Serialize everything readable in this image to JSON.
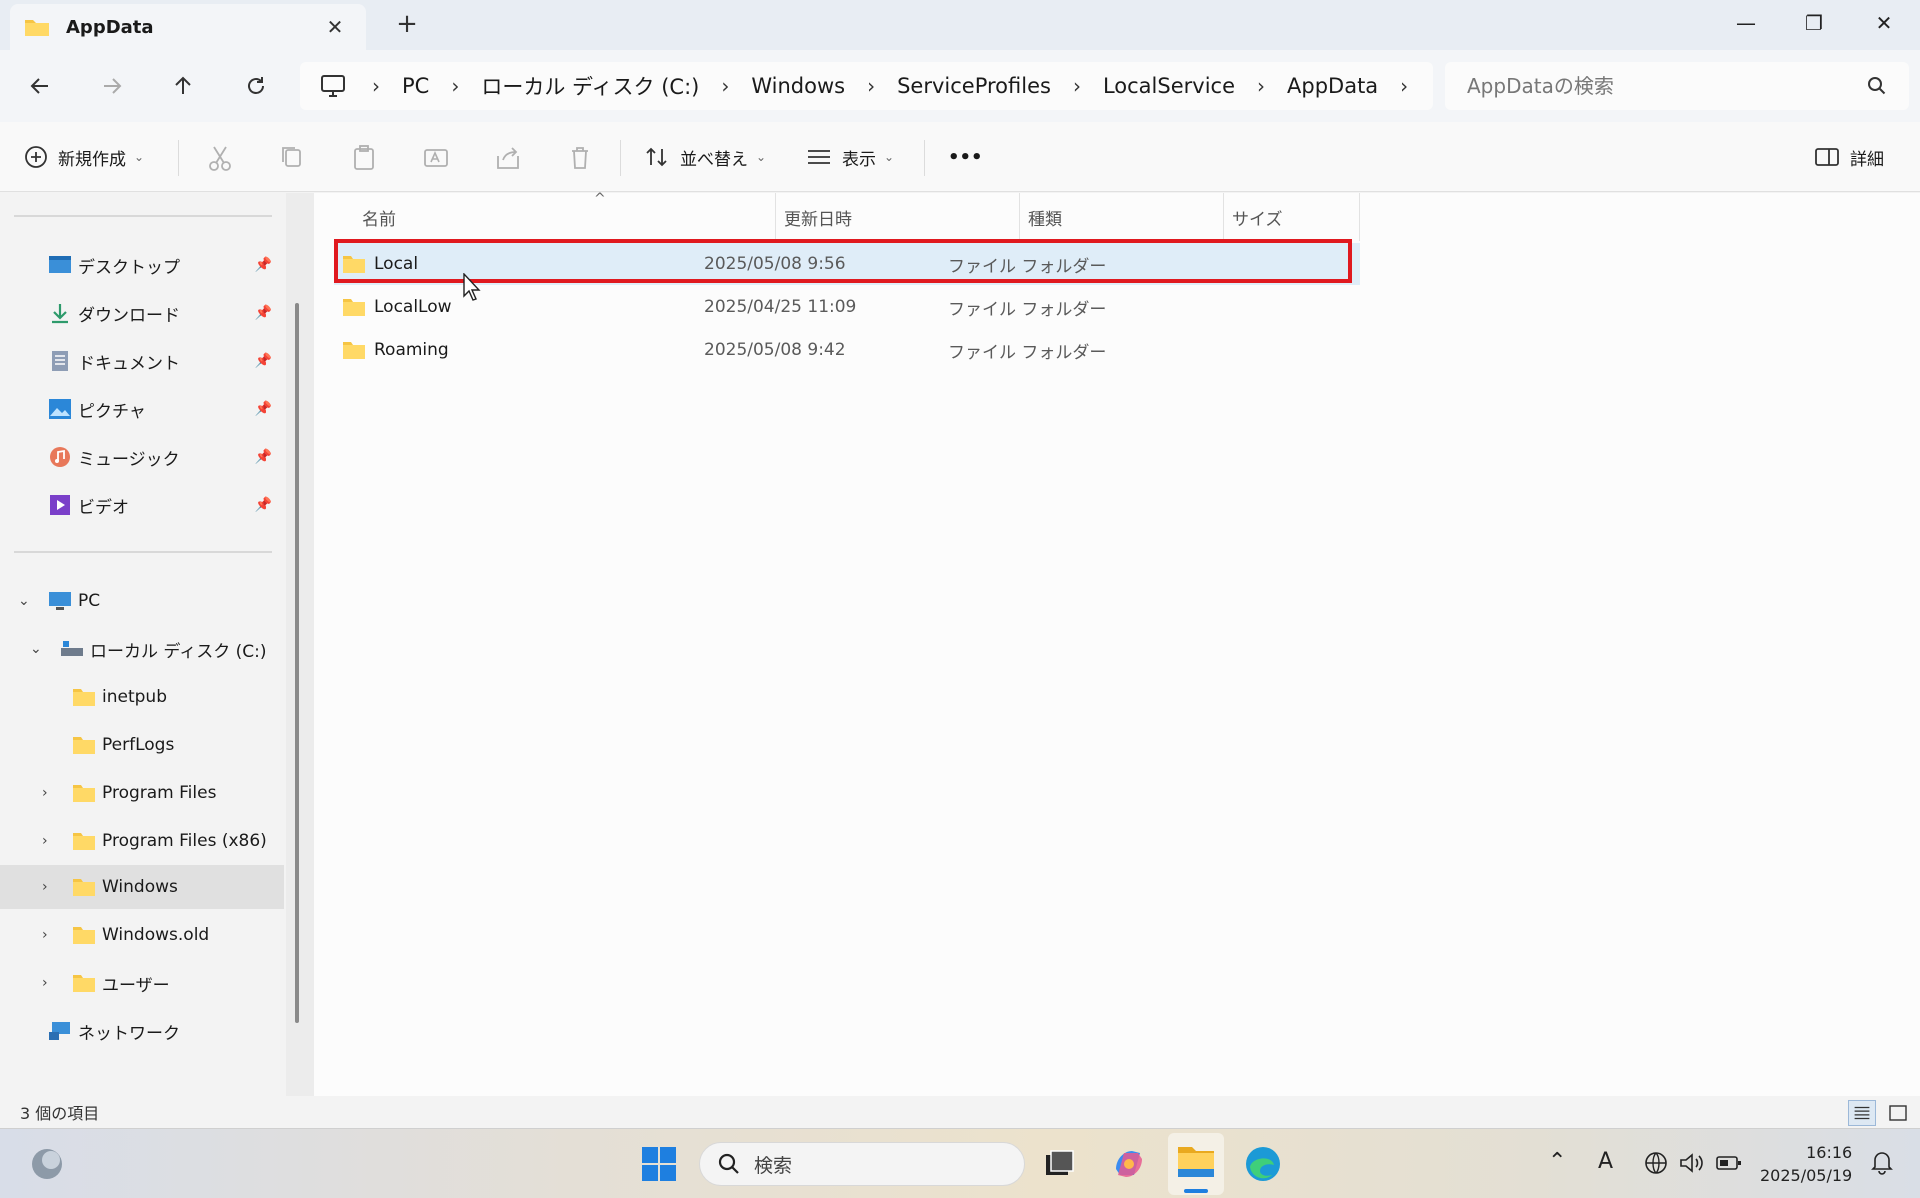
{
  "window": {
    "tab_title": "AppData",
    "tab_close": "✕",
    "new_tab": "+",
    "controls": {
      "minimize": "—",
      "maximize": "❐",
      "close": "✕"
    }
  },
  "address": {
    "crumbs": [
      "PC",
      "ローカル ディスク (C:)",
      "Windows",
      "ServiceProfiles",
      "LocalService",
      "AppData"
    ],
    "separator": "›",
    "search_placeholder": "AppDataの検索"
  },
  "commands": {
    "new": "新規作成",
    "sort": "並べ替え",
    "view": "表示",
    "more": "•••",
    "details": "詳細"
  },
  "sidebar": {
    "quick_access": [
      {
        "label": "デスクトップ",
        "icon": "desktop-icon"
      },
      {
        "label": "ダウンロード",
        "icon": "download-icon"
      },
      {
        "label": "ドキュメント",
        "icon": "documents-icon"
      },
      {
        "label": "ピクチャ",
        "icon": "pictures-icon"
      },
      {
        "label": "ミュージック",
        "icon": "music-icon"
      },
      {
        "label": "ビデオ",
        "icon": "videos-icon"
      }
    ],
    "tree": {
      "pc": "PC",
      "drive": "ローカル ディスク (C:)",
      "folders": [
        "inetpub",
        "PerfLogs",
        "Program Files",
        "Program Files (x86)",
        "Windows",
        "Windows.old",
        "ユーザー"
      ],
      "network": "ネットワーク"
    },
    "selected": "Windows"
  },
  "columns": {
    "name": "名前",
    "date": "更新日時",
    "type": "種類",
    "size": "サイズ"
  },
  "files": [
    {
      "name": "Local",
      "date": "2025/05/08 9:56",
      "type": "ファイル フォルダー",
      "size": ""
    },
    {
      "name": "LocalLow",
      "date": "2025/04/25 11:09",
      "type": "ファイル フォルダー",
      "size": ""
    },
    {
      "name": "Roaming",
      "date": "2025/05/08 9:42",
      "type": "ファイル フォルダー",
      "size": ""
    }
  ],
  "status": {
    "item_count": "3 個の項目"
  },
  "taskbar": {
    "search_label": "検索",
    "time": "16:16",
    "date": "2025/05/19",
    "ime": "A"
  },
  "colors": {
    "highlight_box": "#e0191f",
    "selected_row": "#dfedf8",
    "folder": "#f6c544"
  }
}
